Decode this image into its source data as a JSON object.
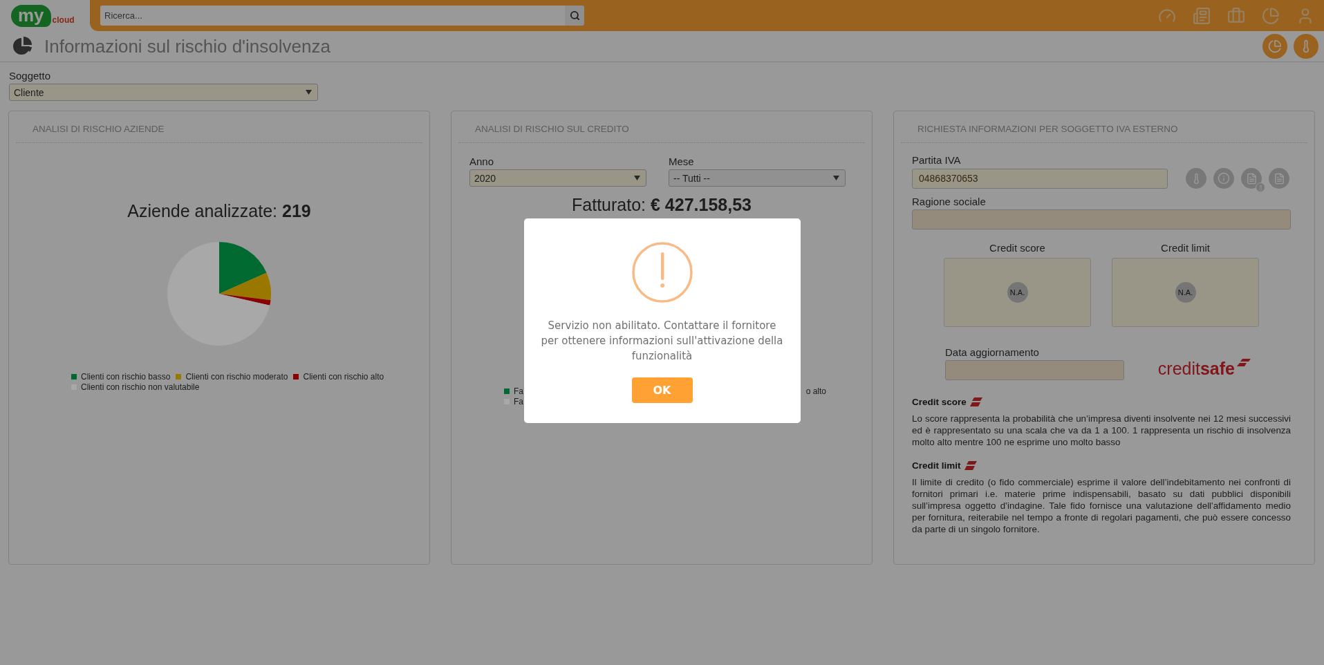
{
  "header": {
    "logo": {
      "main": "my",
      "sub": "cloud"
    },
    "search": {
      "placeholder": "Ricerca..."
    }
  },
  "page_title": "Informazioni sul rischio d'insolvenza",
  "subject": {
    "label": "Soggetto",
    "value": "Cliente"
  },
  "company_risk_panel": {
    "title": "ANALISI DI RISCHIO AZIENDE",
    "headline": "Aziende analizzate: **219**",
    "legend": [
      {
        "label": "Clienti con rischio basso",
        "color": "#006a30"
      },
      {
        "label": "Clienti con rischio moderato",
        "color": "#9a7800"
      },
      {
        "label": "Clienti con rischio alto",
        "color": "#8a0000"
      },
      {
        "label": "Clienti con rischio non valutabile",
        "color": "#a8a8a8"
      }
    ]
  },
  "credit_risk_panel": {
    "title": "ANALISI DI RISCHIO SUL CREDITO",
    "year": {
      "label": "Anno",
      "value": "2020"
    },
    "month": {
      "label": "Mese",
      "value": "-- Tutti --"
    },
    "headline": "Fatturato: **€ 427.158,53**",
    "legend": [
      {
        "label": "Fa",
        "color": "#006a30"
      },
      {
        "label": "Fa",
        "color": "#a8a8a8"
      }
    ],
    "legend_fragment": "o alto"
  },
  "external_vat_panel": {
    "title": "RICHIESTA INFORMAZIONI PER SOGGETTO IVA ESTERNO",
    "vat": {
      "label": "Partita IVA",
      "value": "04868370653"
    },
    "company_name": {
      "label": "Ragione sociale"
    },
    "scores": [
      {
        "label": "Credit score",
        "value": "N.A."
      },
      {
        "label": "Credit limit",
        "value": "N.A."
      }
    ],
    "update_date": {
      "label": "Data aggiornamento"
    },
    "provider_logo": "credit**safe**",
    "notes": [
      {
        "heading": "Credit score",
        "text": "Lo score rappresenta la probabilità che un’impresa diventi insolvente nei 12 mesi successivi ed è rappresentato su una scala che va da 1 a 100. 1 rappresenta un rischio di insolvenza molto alto mentre 100 ne esprime uno molto basso"
      },
      {
        "heading": "Credit limit",
        "text": "Il limite di credito (o fido commerciale) esprime il valore dell’indebitamento nei confronti di fornitori primari i.e. materie prime indispensabili, basato su dati pubblici disponibili sull’impresa oggetto d’indagine. Tale fido fornisce una valutazione dell'affidamento medio per fornitura, reiterabile nel tempo a fronte di regolari pagamenti, che può essere concesso da parte di un singolo fornitore."
      }
    ]
  },
  "dialog": {
    "message": "Servizio non abilitato. Contattare il fornitore per ottenere informazioni sull'attivazione della funzionalità",
    "button": "OK"
  }
}
